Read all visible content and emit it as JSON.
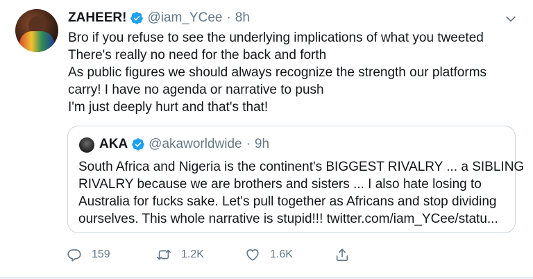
{
  "tweet": {
    "author_name": "ZAHEER!",
    "author_handle": "@iam_YCee",
    "separator": "·",
    "time": "8h",
    "body_lines": [
      "Bro if you refuse to see the underlying implications of what you tweeted",
      "There's really no need for the back and forth",
      "As public figures we should always recognize the strength our platforms",
      "carry! I have no agenda or narrative to push",
      "I'm just deeply hurt and that's that!"
    ],
    "quoted": {
      "author_name": "AKA",
      "author_handle": "@akaworldwide",
      "separator": "·",
      "time": "9h",
      "body_lines": [
        "South Africa and Nigeria is the continent's BIGGEST RIVALRY ... a SIBLING",
        "RIVALRY because we are brothers and sisters  ... I also hate losing to",
        "Australia for fucks sake. Let's pull together as Africans and stop dividing",
        "ourselves. This whole narrative is stupid!!! twitter.com/iam_YCee/statu..."
      ]
    },
    "actions": {
      "reply_count": "159",
      "retweet_count": "1.2K",
      "like_count": "1.6K"
    }
  },
  "icons": {
    "verified": "verified-badge-icon",
    "more": "chevron-down-icon",
    "reply": "reply-icon",
    "retweet": "retweet-icon",
    "like": "heart-icon",
    "share": "share-icon"
  },
  "colors": {
    "verified_blue": "#1da1f2",
    "secondary_text": "#657786",
    "border": "#ccd6dd"
  }
}
